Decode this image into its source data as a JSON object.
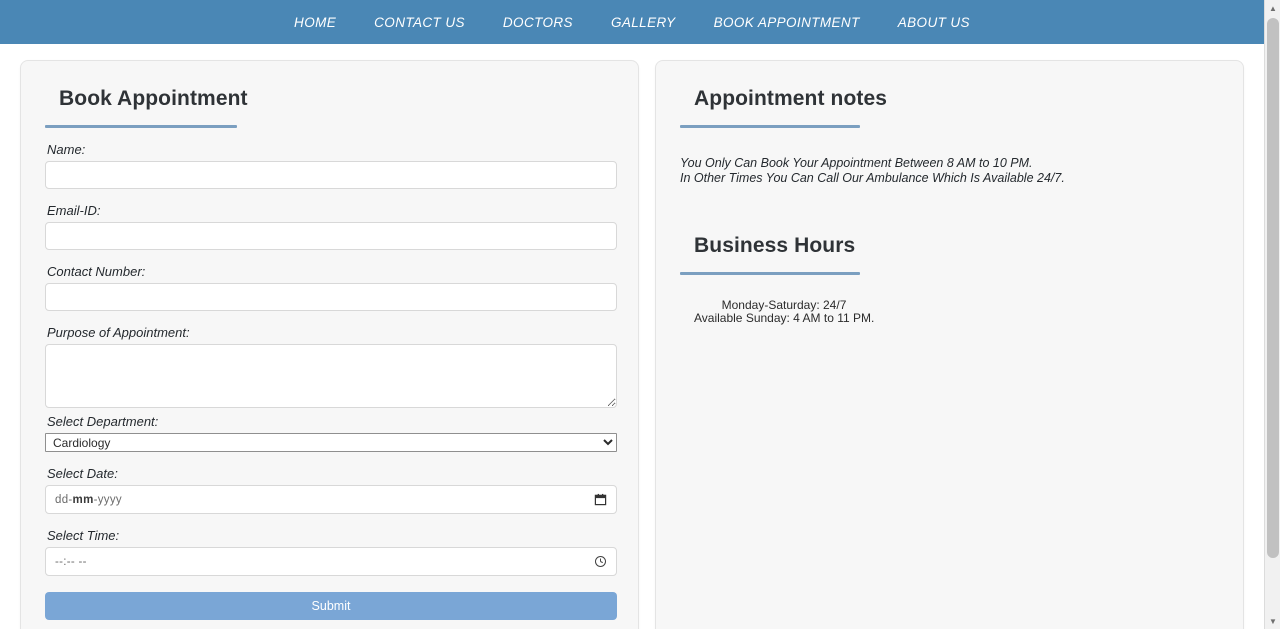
{
  "nav": {
    "items": [
      {
        "label": "HOME",
        "name": "nav-item-home"
      },
      {
        "label": "CONTACT US",
        "name": "nav-item-contact-us"
      },
      {
        "label": "DOCTORS",
        "name": "nav-item-doctors"
      },
      {
        "label": "GALLERY",
        "name": "nav-item-gallery"
      },
      {
        "label": "BOOK APPOINTMENT",
        "name": "nav-item-book-appointment"
      },
      {
        "label": "ABOUT US",
        "name": "nav-item-about-us"
      }
    ]
  },
  "book_panel": {
    "heading": "Book Appointment",
    "fields": {
      "name_label": "Name:",
      "name_value": "",
      "email_label": "Email-ID:",
      "email_value": "",
      "contact_label": "Contact Number:",
      "contact_value": "",
      "purpose_label": "Purpose of Appointment:",
      "purpose_value": "",
      "department_label": "Select Department:",
      "department_value": "Cardiology",
      "department_options": [
        "Cardiology"
      ],
      "date_label": "Select Date:",
      "date_placeholder_day": "dd",
      "date_placeholder_month": "mm",
      "date_placeholder_year": "yyyy",
      "date_separator": "-",
      "time_label": "Select Time:",
      "time_placeholder": "--:-- --"
    },
    "submit_label": "Submit"
  },
  "notes_panel": {
    "heading": "Appointment notes",
    "line1": "You Only Can Book Your Appointment Between 8 AM to 10 PM.",
    "line2": "In Other Times You Can Call Our Ambulance Which Is Available 24/7."
  },
  "hours_panel": {
    "heading": "Business Hours",
    "line1": "Monday-Saturday: 24/7",
    "line2": "Available Sunday: 4 AM to 11 PM."
  },
  "colors": {
    "navbar": "#4a87b5",
    "accent_rule": "#7b9fc0",
    "submit": "#7aa6d6",
    "panel_bg": "#f7f7f7"
  }
}
